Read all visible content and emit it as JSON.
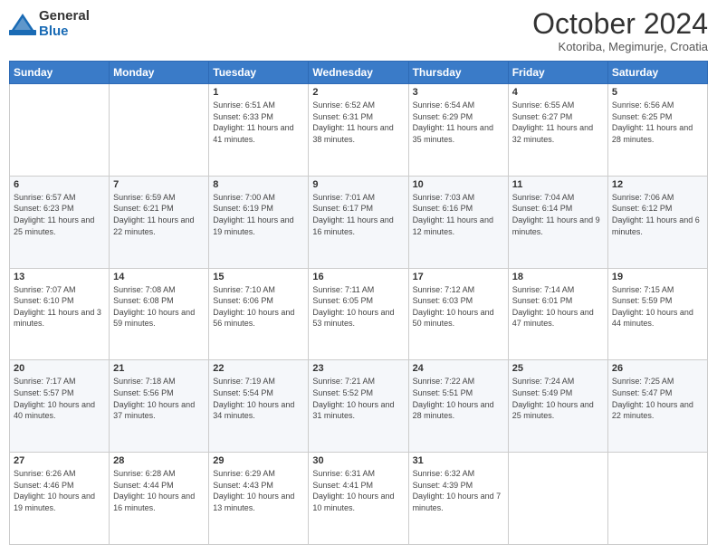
{
  "header": {
    "logo_general": "General",
    "logo_blue": "Blue",
    "month_title": "October 2024",
    "location": "Kotoriba, Megimurje, Croatia"
  },
  "days_of_week": [
    "Sunday",
    "Monday",
    "Tuesday",
    "Wednesday",
    "Thursday",
    "Friday",
    "Saturday"
  ],
  "weeks": [
    [
      {
        "day": "",
        "sunrise": "",
        "sunset": "",
        "daylight": ""
      },
      {
        "day": "",
        "sunrise": "",
        "sunset": "",
        "daylight": ""
      },
      {
        "day": "1",
        "sunrise": "Sunrise: 6:51 AM",
        "sunset": "Sunset: 6:33 PM",
        "daylight": "Daylight: 11 hours and 41 minutes."
      },
      {
        "day": "2",
        "sunrise": "Sunrise: 6:52 AM",
        "sunset": "Sunset: 6:31 PM",
        "daylight": "Daylight: 11 hours and 38 minutes."
      },
      {
        "day": "3",
        "sunrise": "Sunrise: 6:54 AM",
        "sunset": "Sunset: 6:29 PM",
        "daylight": "Daylight: 11 hours and 35 minutes."
      },
      {
        "day": "4",
        "sunrise": "Sunrise: 6:55 AM",
        "sunset": "Sunset: 6:27 PM",
        "daylight": "Daylight: 11 hours and 32 minutes."
      },
      {
        "day": "5",
        "sunrise": "Sunrise: 6:56 AM",
        "sunset": "Sunset: 6:25 PM",
        "daylight": "Daylight: 11 hours and 28 minutes."
      }
    ],
    [
      {
        "day": "6",
        "sunrise": "Sunrise: 6:57 AM",
        "sunset": "Sunset: 6:23 PM",
        "daylight": "Daylight: 11 hours and 25 minutes."
      },
      {
        "day": "7",
        "sunrise": "Sunrise: 6:59 AM",
        "sunset": "Sunset: 6:21 PM",
        "daylight": "Daylight: 11 hours and 22 minutes."
      },
      {
        "day": "8",
        "sunrise": "Sunrise: 7:00 AM",
        "sunset": "Sunset: 6:19 PM",
        "daylight": "Daylight: 11 hours and 19 minutes."
      },
      {
        "day": "9",
        "sunrise": "Sunrise: 7:01 AM",
        "sunset": "Sunset: 6:17 PM",
        "daylight": "Daylight: 11 hours and 16 minutes."
      },
      {
        "day": "10",
        "sunrise": "Sunrise: 7:03 AM",
        "sunset": "Sunset: 6:16 PM",
        "daylight": "Daylight: 11 hours and 12 minutes."
      },
      {
        "day": "11",
        "sunrise": "Sunrise: 7:04 AM",
        "sunset": "Sunset: 6:14 PM",
        "daylight": "Daylight: 11 hours and 9 minutes."
      },
      {
        "day": "12",
        "sunrise": "Sunrise: 7:06 AM",
        "sunset": "Sunset: 6:12 PM",
        "daylight": "Daylight: 11 hours and 6 minutes."
      }
    ],
    [
      {
        "day": "13",
        "sunrise": "Sunrise: 7:07 AM",
        "sunset": "Sunset: 6:10 PM",
        "daylight": "Daylight: 11 hours and 3 minutes."
      },
      {
        "day": "14",
        "sunrise": "Sunrise: 7:08 AM",
        "sunset": "Sunset: 6:08 PM",
        "daylight": "Daylight: 10 hours and 59 minutes."
      },
      {
        "day": "15",
        "sunrise": "Sunrise: 7:10 AM",
        "sunset": "Sunset: 6:06 PM",
        "daylight": "Daylight: 10 hours and 56 minutes."
      },
      {
        "day": "16",
        "sunrise": "Sunrise: 7:11 AM",
        "sunset": "Sunset: 6:05 PM",
        "daylight": "Daylight: 10 hours and 53 minutes."
      },
      {
        "day": "17",
        "sunrise": "Sunrise: 7:12 AM",
        "sunset": "Sunset: 6:03 PM",
        "daylight": "Daylight: 10 hours and 50 minutes."
      },
      {
        "day": "18",
        "sunrise": "Sunrise: 7:14 AM",
        "sunset": "Sunset: 6:01 PM",
        "daylight": "Daylight: 10 hours and 47 minutes."
      },
      {
        "day": "19",
        "sunrise": "Sunrise: 7:15 AM",
        "sunset": "Sunset: 5:59 PM",
        "daylight": "Daylight: 10 hours and 44 minutes."
      }
    ],
    [
      {
        "day": "20",
        "sunrise": "Sunrise: 7:17 AM",
        "sunset": "Sunset: 5:57 PM",
        "daylight": "Daylight: 10 hours and 40 minutes."
      },
      {
        "day": "21",
        "sunrise": "Sunrise: 7:18 AM",
        "sunset": "Sunset: 5:56 PM",
        "daylight": "Daylight: 10 hours and 37 minutes."
      },
      {
        "day": "22",
        "sunrise": "Sunrise: 7:19 AM",
        "sunset": "Sunset: 5:54 PM",
        "daylight": "Daylight: 10 hours and 34 minutes."
      },
      {
        "day": "23",
        "sunrise": "Sunrise: 7:21 AM",
        "sunset": "Sunset: 5:52 PM",
        "daylight": "Daylight: 10 hours and 31 minutes."
      },
      {
        "day": "24",
        "sunrise": "Sunrise: 7:22 AM",
        "sunset": "Sunset: 5:51 PM",
        "daylight": "Daylight: 10 hours and 28 minutes."
      },
      {
        "day": "25",
        "sunrise": "Sunrise: 7:24 AM",
        "sunset": "Sunset: 5:49 PM",
        "daylight": "Daylight: 10 hours and 25 minutes."
      },
      {
        "day": "26",
        "sunrise": "Sunrise: 7:25 AM",
        "sunset": "Sunset: 5:47 PM",
        "daylight": "Daylight: 10 hours and 22 minutes."
      }
    ],
    [
      {
        "day": "27",
        "sunrise": "Sunrise: 6:26 AM",
        "sunset": "Sunset: 4:46 PM",
        "daylight": "Daylight: 10 hours and 19 minutes."
      },
      {
        "day": "28",
        "sunrise": "Sunrise: 6:28 AM",
        "sunset": "Sunset: 4:44 PM",
        "daylight": "Daylight: 10 hours and 16 minutes."
      },
      {
        "day": "29",
        "sunrise": "Sunrise: 6:29 AM",
        "sunset": "Sunset: 4:43 PM",
        "daylight": "Daylight: 10 hours and 13 minutes."
      },
      {
        "day": "30",
        "sunrise": "Sunrise: 6:31 AM",
        "sunset": "Sunset: 4:41 PM",
        "daylight": "Daylight: 10 hours and 10 minutes."
      },
      {
        "day": "31",
        "sunrise": "Sunrise: 6:32 AM",
        "sunset": "Sunset: 4:39 PM",
        "daylight": "Daylight: 10 hours and 7 minutes."
      },
      {
        "day": "",
        "sunrise": "",
        "sunset": "",
        "daylight": ""
      },
      {
        "day": "",
        "sunrise": "",
        "sunset": "",
        "daylight": ""
      }
    ]
  ]
}
